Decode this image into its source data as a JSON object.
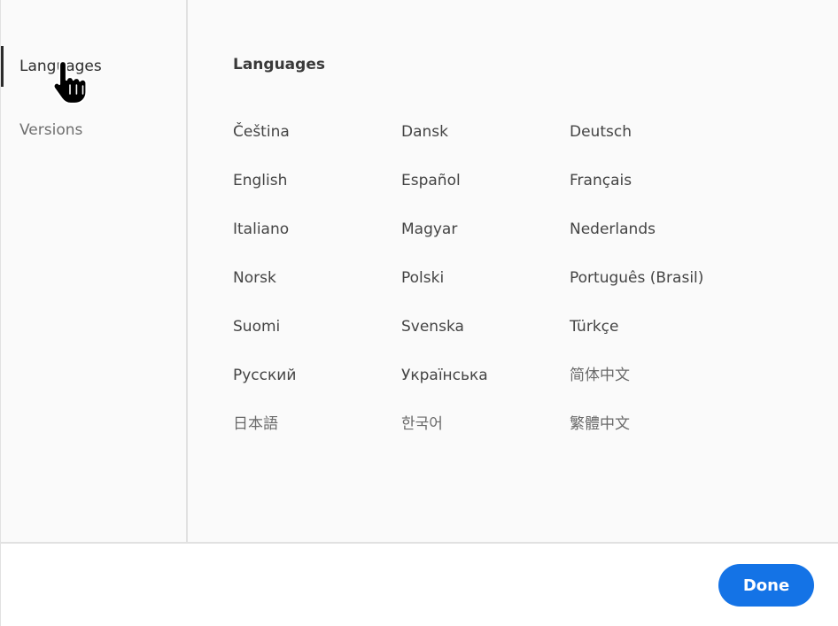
{
  "sidebar": {
    "items": [
      {
        "label": "Languages",
        "active": true
      },
      {
        "label": "Versions",
        "active": false
      }
    ]
  },
  "main": {
    "title": "Languages",
    "languages": [
      "Čeština",
      "Dansk",
      "Deutsch",
      "English",
      "Español",
      "Français",
      "Italiano",
      "Magyar",
      "Nederlands",
      "Norsk",
      "Polski",
      "Português (Brasil)",
      "Suomi",
      "Svenska",
      "Türkçe",
      "Русский",
      "Українська",
      "简体中文",
      "日本語",
      "한국어",
      "繁體中文"
    ]
  },
  "footer": {
    "done_label": "Done"
  },
  "colors": {
    "accent": "#1473e6",
    "active_indicator": "#2c2c2c",
    "divider": "#e1e1e1",
    "panel_bg": "#fafafa"
  },
  "icons": {
    "cursor": "hand-pointer-icon"
  }
}
